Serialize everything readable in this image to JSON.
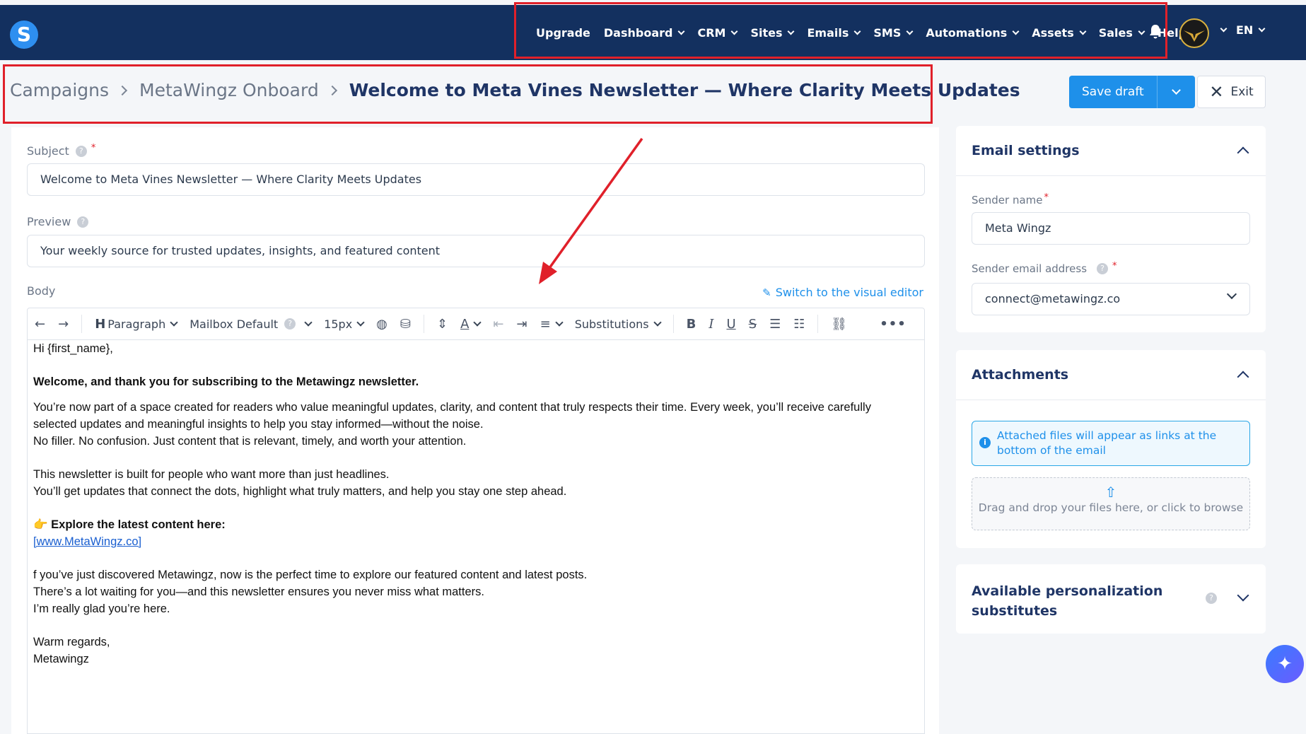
{
  "nav": {
    "logo": "S",
    "items": [
      {
        "label": "Upgrade",
        "has_menu": false
      },
      {
        "label": "Dashboard",
        "has_menu": true
      },
      {
        "label": "CRM",
        "has_menu": true
      },
      {
        "label": "Sites",
        "has_menu": true
      },
      {
        "label": "Emails",
        "has_menu": true
      },
      {
        "label": "SMS",
        "has_menu": true
      },
      {
        "label": "Automations",
        "has_menu": true
      },
      {
        "label": "Assets",
        "has_menu": true
      },
      {
        "label": "Sales",
        "has_menu": true
      },
      {
        "label": "Help",
        "has_menu": false
      }
    ],
    "language": "EN"
  },
  "breadcrumb": {
    "items": [
      "Campaigns",
      "MetaWingz Onboard"
    ],
    "current": "Welcome to Meta Vines Newsletter — Where Clarity Meets Updates"
  },
  "actions": {
    "save_label": "Save draft",
    "exit_label": "Exit"
  },
  "form": {
    "subject_label": "Subject",
    "subject_value": "Welcome to Meta Vines Newsletter — Where Clarity Meets Updates",
    "preview_label": "Preview",
    "preview_value": "Your weekly source for trusted updates, insights, and featured content",
    "body_label": "Body",
    "switch_label": "Switch to the visual editor"
  },
  "toolbar": {
    "paragraph": "Paragraph",
    "font": "Mailbox Default",
    "size": "15px",
    "substitutions": "Substitutions"
  },
  "body": {
    "greeting": "Hi {first_name},",
    "headline": "Welcome, and thank you for subscribing to the Metawingz newsletter.",
    "p1a": "You’re now part of a space created for readers who value meaningful updates, clarity, and content that truly respects their time. Every week, you’ll receive carefully",
    "p1b": "selected updates and meaningful insights to help you stay informed—without the noise.",
    "p1c": "No filler. No confusion. Just content that is relevant, timely, and worth your attention.",
    "p2a": "This newsletter is built for people who want more than just headlines.",
    "p2b": "You’ll get updates that connect the dots, highlight what truly matters, and help you stay one step ahead.",
    "explore": "Explore the latest content here:",
    "link": "[www.MetaWingz.co]",
    "p3a": "f you’ve just discovered Metawingz, now is the perfect time to explore our featured content and latest posts.",
    "p3b": "There’s a lot waiting for you—and this newsletter ensures you never miss what matters.",
    "p3c": "I’m really glad you’re here.",
    "closing": "Warm regards,",
    "signature": "Metawingz"
  },
  "settings": {
    "title": "Email settings",
    "sender_name_label": "Sender name",
    "sender_name_value": "Meta Wingz",
    "sender_email_label": "Sender email address",
    "sender_email_value": "connect@metawingz.co"
  },
  "attachments": {
    "title": "Attachments",
    "info": "Attached files will appear as links at the bottom of the email",
    "drop": "Drag and drop your files here, or click to browse"
  },
  "personalization": {
    "title_line1": "Available personalization",
    "title_line2": "substitutes"
  },
  "colors": {
    "nav_bg": "#13305f",
    "accent": "#1e90ea",
    "annotation": "#e0202a"
  }
}
